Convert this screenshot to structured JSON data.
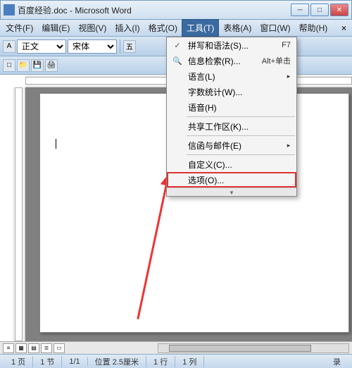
{
  "title": "百度经验.doc - Microsoft Word",
  "menubar": {
    "file": "文件(F)",
    "edit": "编辑(E)",
    "view": "视图(V)",
    "insert": "插入(I)",
    "format": "格式(O)",
    "tools": "工具(T)",
    "table": "表格(A)",
    "window": "窗口(W)",
    "help": "帮助(H)"
  },
  "toolbar": {
    "style_select": "正文",
    "font_select": "宋体"
  },
  "dropdown": {
    "items": [
      {
        "icon": "✓",
        "label": "拼写和语法(S)...",
        "shortcut": "F7",
        "arrow": ""
      },
      {
        "icon": "🔍",
        "label": "信息检索(R)...",
        "shortcut": "Alt+单击",
        "arrow": ""
      },
      {
        "icon": "",
        "label": "语言(L)",
        "shortcut": "",
        "arrow": "▸"
      },
      {
        "icon": "",
        "label": "字数统计(W)...",
        "shortcut": "",
        "arrow": ""
      },
      {
        "icon": "",
        "label": "语音(H)",
        "shortcut": "",
        "arrow": ""
      },
      {
        "sep": true
      },
      {
        "icon": "",
        "label": "共享工作区(K)...",
        "shortcut": "",
        "arrow": ""
      },
      {
        "sep": true
      },
      {
        "icon": "",
        "label": "信函与邮件(E)",
        "shortcut": "",
        "arrow": "▸"
      },
      {
        "sep": true
      },
      {
        "icon": "",
        "label": "自定义(C)...",
        "shortcut": "",
        "arrow": ""
      },
      {
        "icon": "",
        "label": "选项(O)...",
        "shortcut": "",
        "arrow": "",
        "highlighted": true
      }
    ],
    "expand": "▾"
  },
  "statusbar": {
    "page": "1 页",
    "section": "1 节",
    "pages": "1/1",
    "position": "位置 2.5厘米",
    "line": "1 行",
    "column": "1 列",
    "rec": "录"
  }
}
